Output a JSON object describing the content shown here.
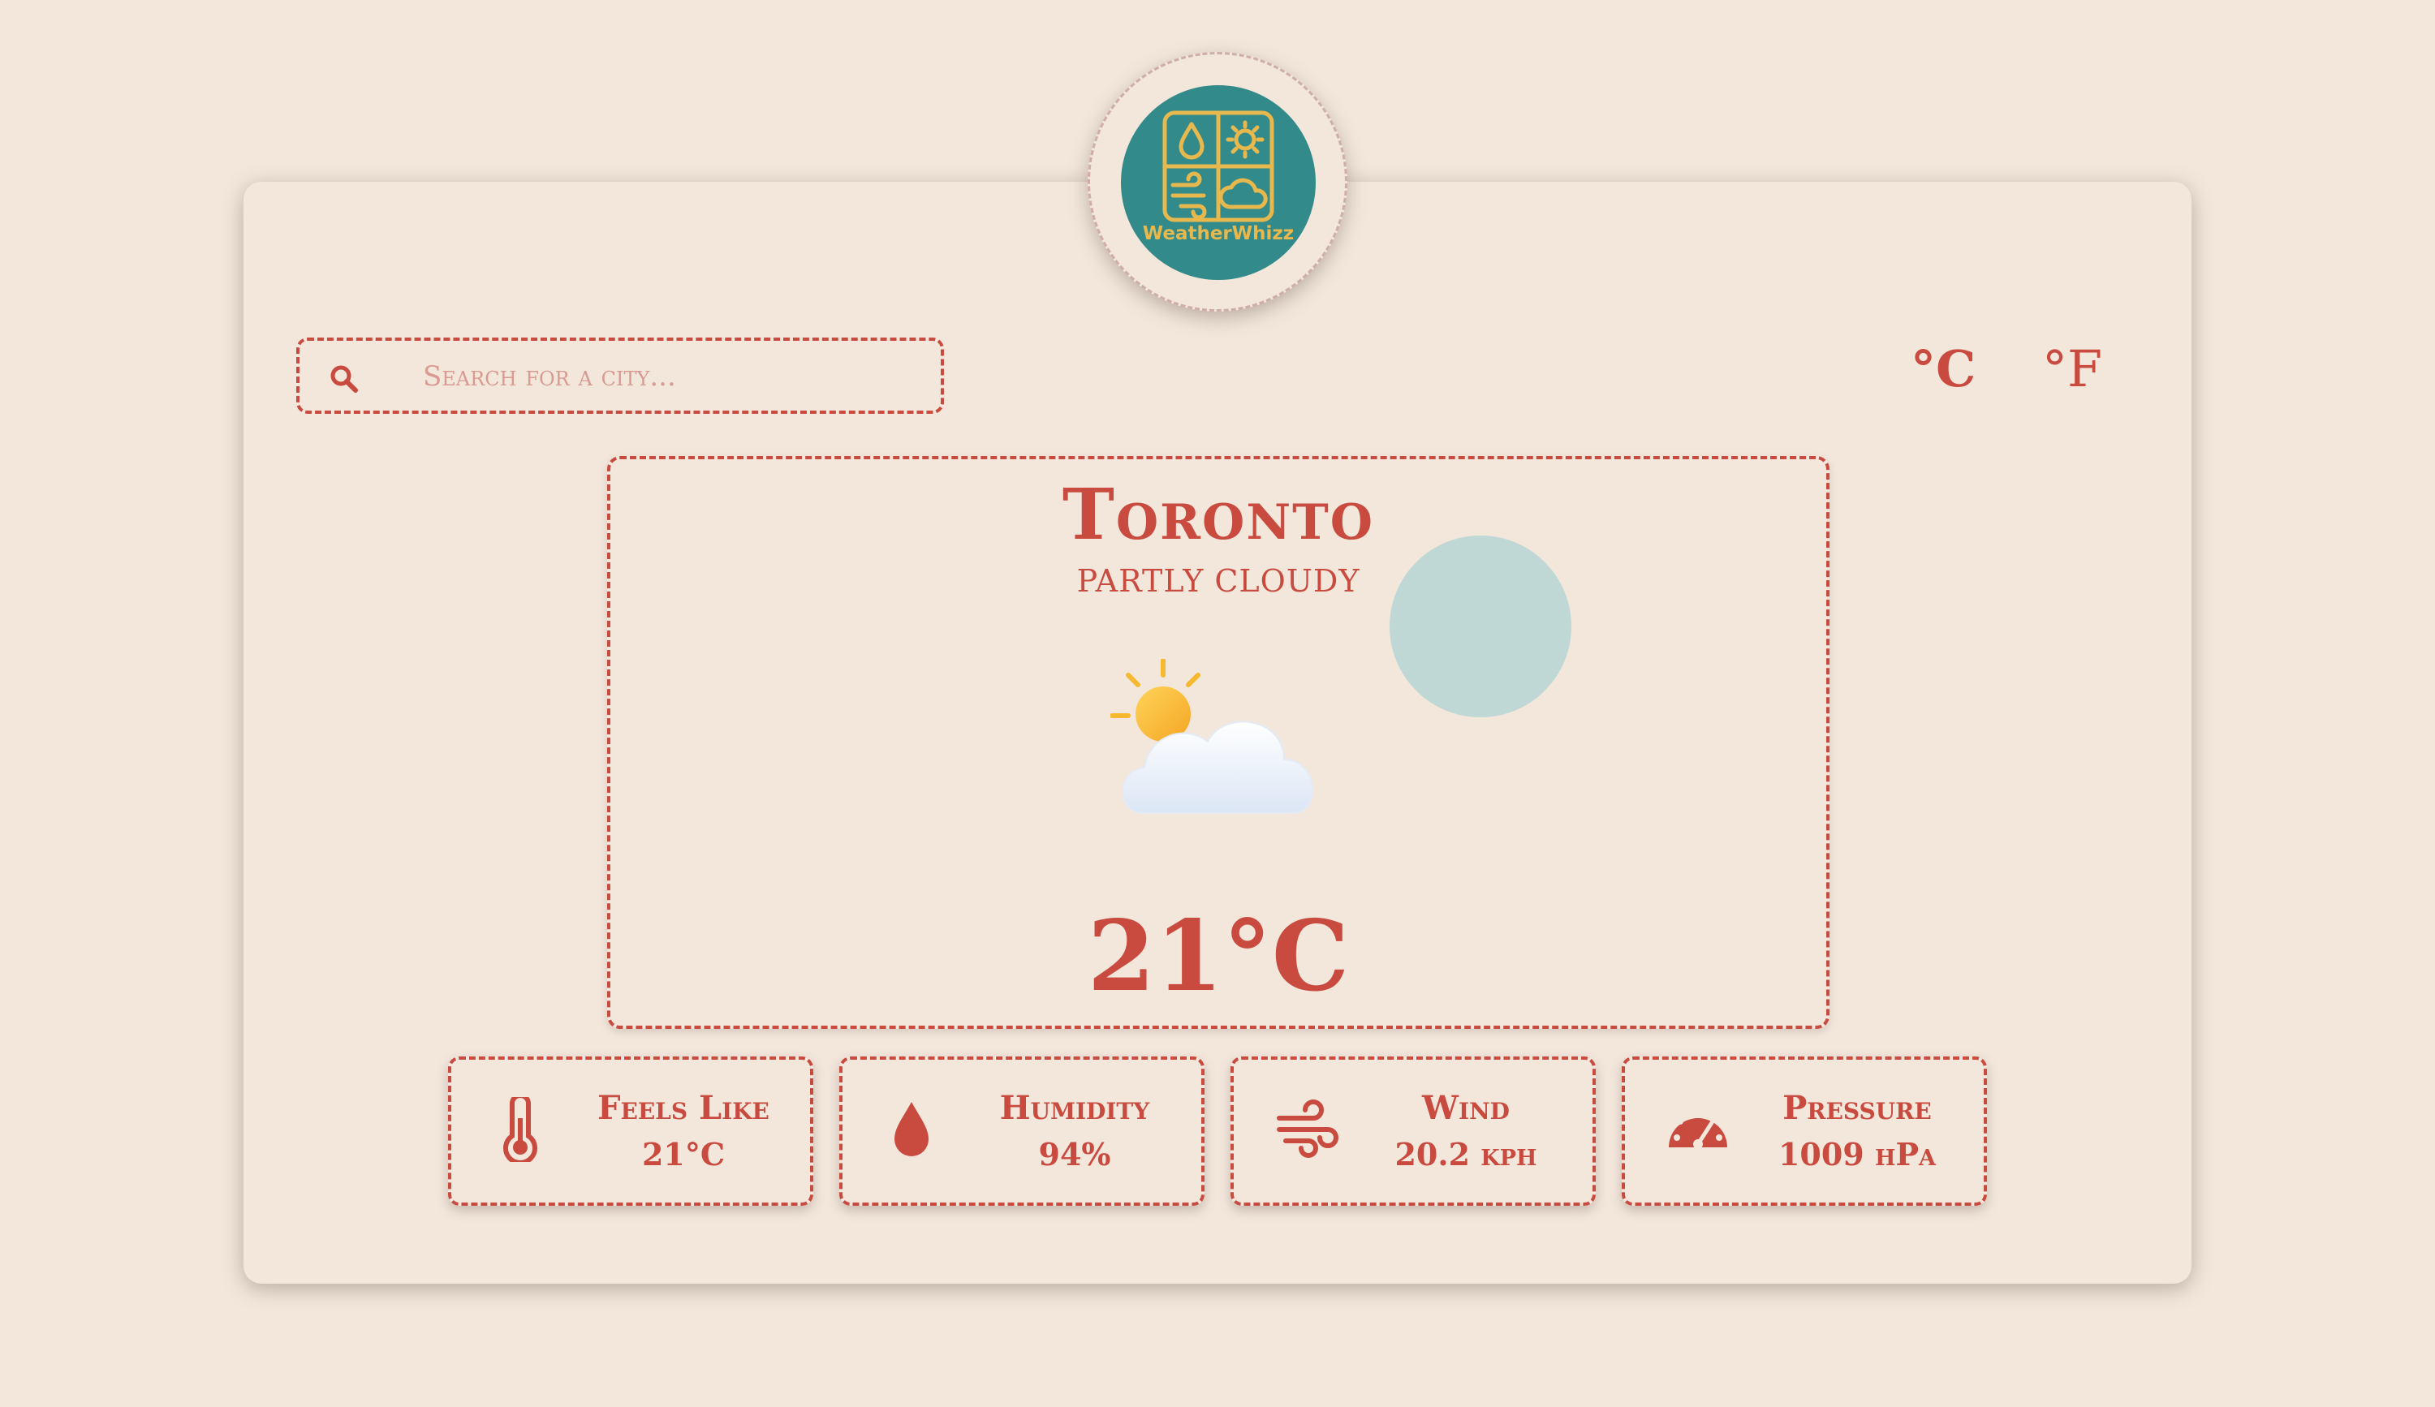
{
  "app": {
    "logo_text": "WeatherWhizz"
  },
  "search": {
    "placeholder": "Search for a city..."
  },
  "units": {
    "celsius": "°C",
    "fahrenheit": "°F",
    "selected": "°C"
  },
  "current": {
    "city": "Toronto",
    "condition": "PARTLY CLOUDY",
    "temperature": "21°C",
    "icon": "partly-cloudy-icon"
  },
  "details": [
    {
      "label": "Feels Like",
      "value": "21°C",
      "icon": "thermometer-icon"
    },
    {
      "label": "Humidity",
      "value": "94%",
      "icon": "droplet-icon"
    },
    {
      "label": "Wind",
      "value": "20.2 kph",
      "icon": "wind-icon"
    },
    {
      "label": "Pressure",
      "value": "1009 hPa",
      "icon": "gauge-icon"
    }
  ],
  "colors": {
    "accent": "#c94b3f",
    "background": "#f3e7dc",
    "logo": "#338a8a",
    "logo_text": "#e6b84e",
    "blob": "#bfd8d6"
  }
}
